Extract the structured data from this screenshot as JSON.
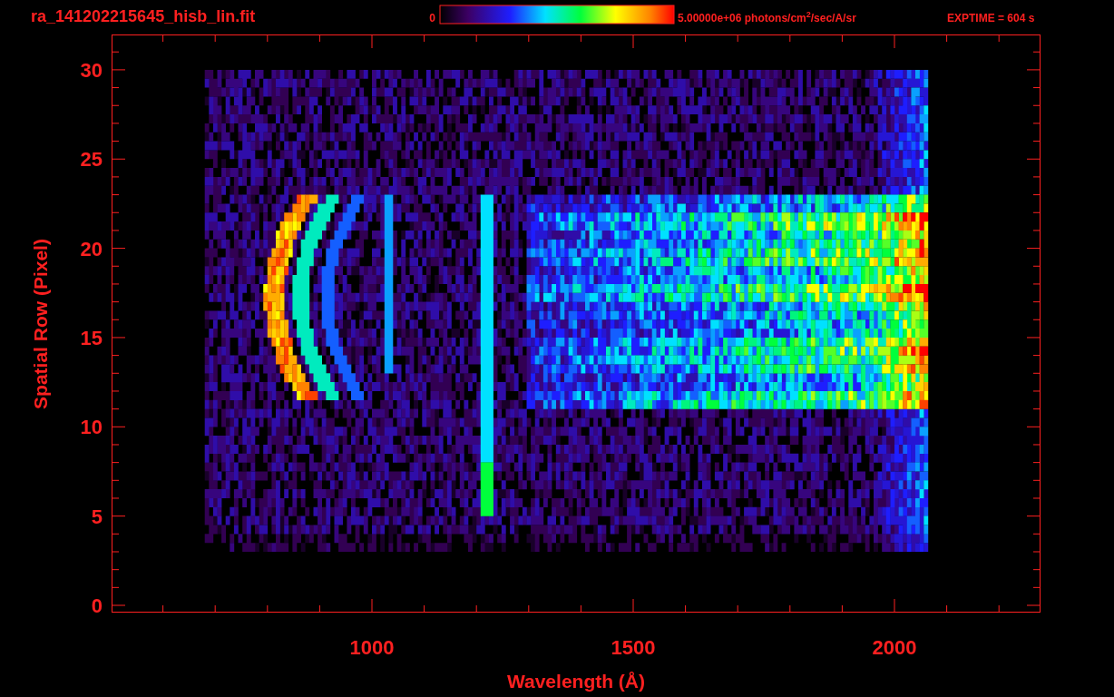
{
  "title": "ra_141202215645_hisb_lin.fit",
  "colorbar": {
    "min_label": "0",
    "max_label": "5.00000e+06 photons/cm$^{2}$/sec/A/sr"
  },
  "exptime": "EXPTIME = 604 s",
  "x_axis": {
    "label": "Wavelength (Å)",
    "ticks": [
      "1000",
      "1500",
      "2000"
    ]
  },
  "y_axis": {
    "label": "Spatial Row (Pixel)",
    "ticks": [
      "30",
      "25",
      "20",
      "15",
      "10",
      "5",
      "0"
    ]
  }
}
